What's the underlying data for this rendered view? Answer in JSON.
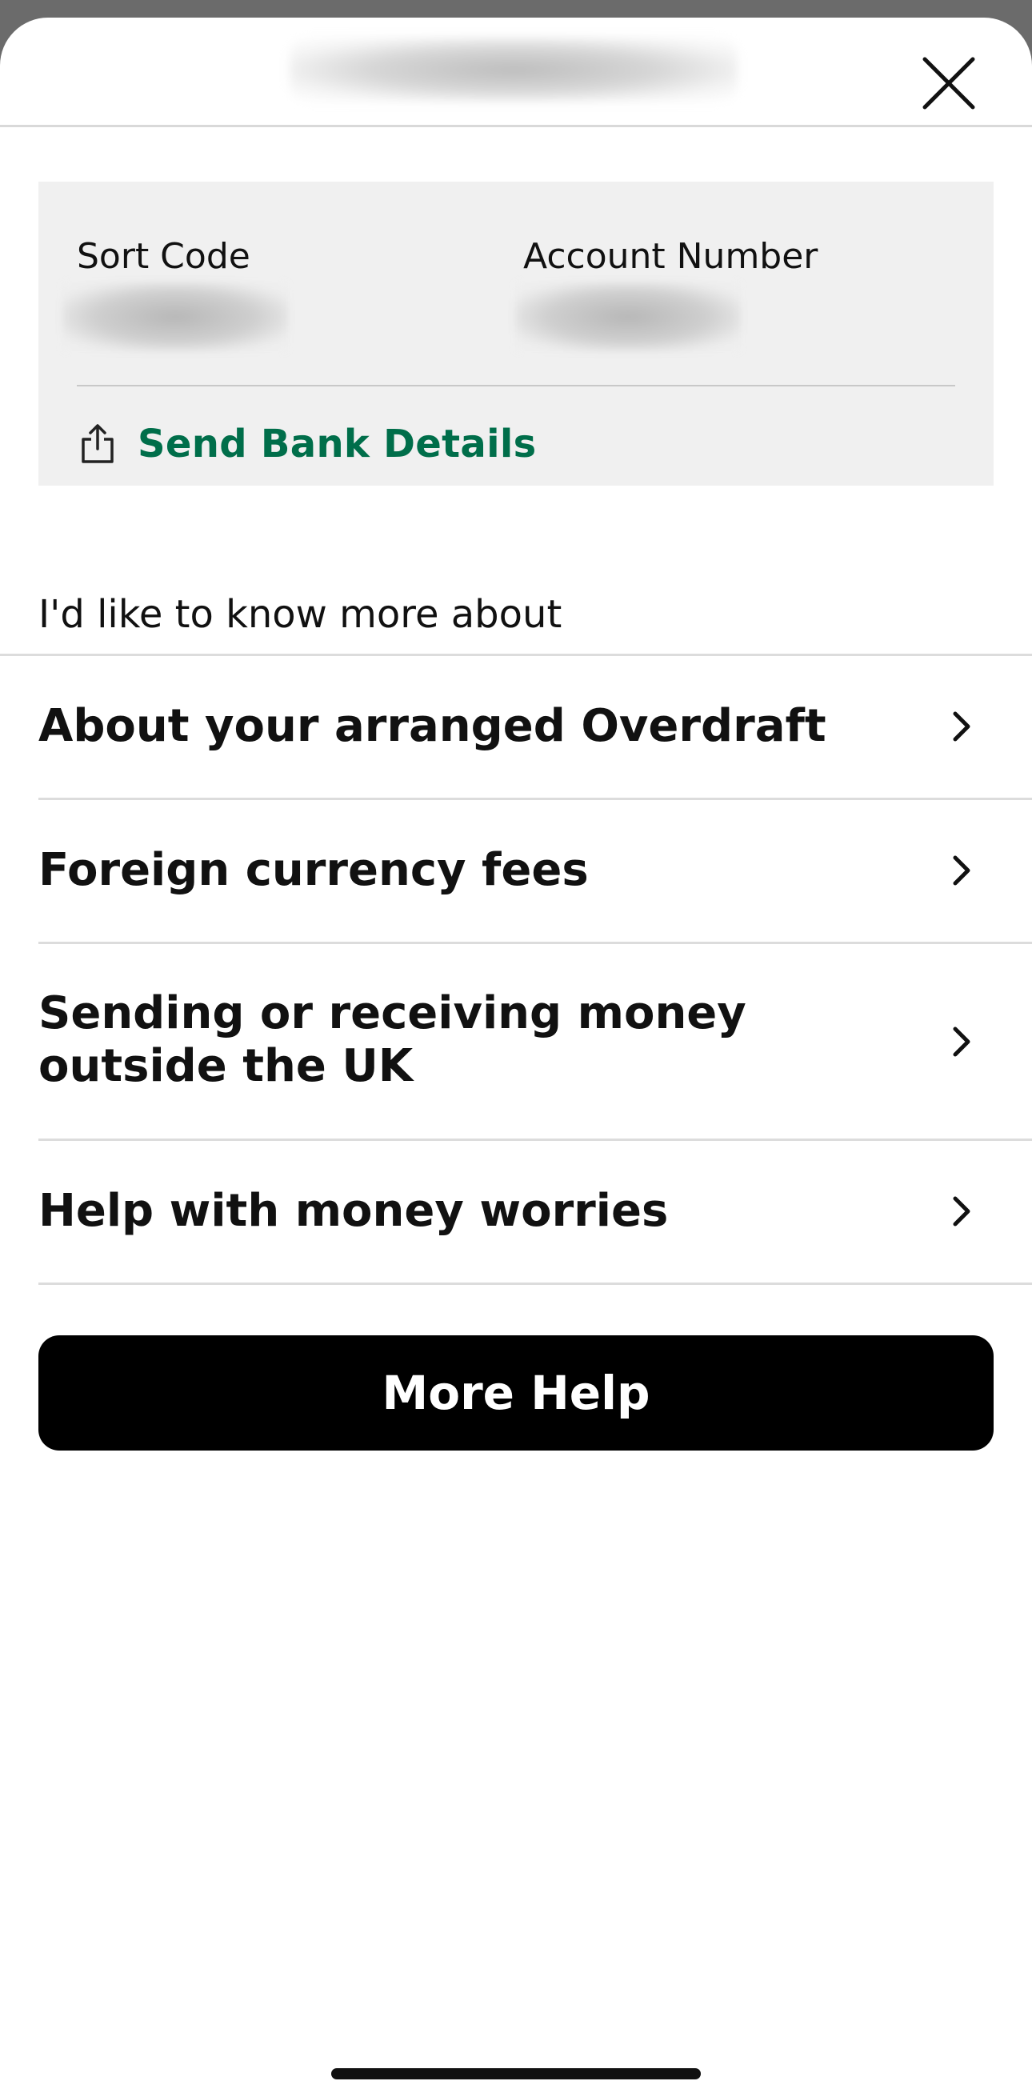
{
  "header": {
    "close_icon": "close-icon"
  },
  "bank_details": {
    "sort_code_label": "Sort Code",
    "account_number_label": "Account Number",
    "send_label": "Send Bank Details",
    "send_icon": "share-icon",
    "accent_color": "#006e4a"
  },
  "help": {
    "intro": "I'd like to know more about",
    "items": [
      {
        "label": "About your arranged Overdraft",
        "icon": "chevron-right-icon"
      },
      {
        "label": "Foreign currency fees",
        "icon": "chevron-right-icon"
      },
      {
        "label": "Sending or receiving money outside the UK",
        "icon": "chevron-right-icon"
      },
      {
        "label": "Help with money worries",
        "icon": "chevron-right-icon"
      }
    ],
    "more_help_label": "More Help"
  }
}
